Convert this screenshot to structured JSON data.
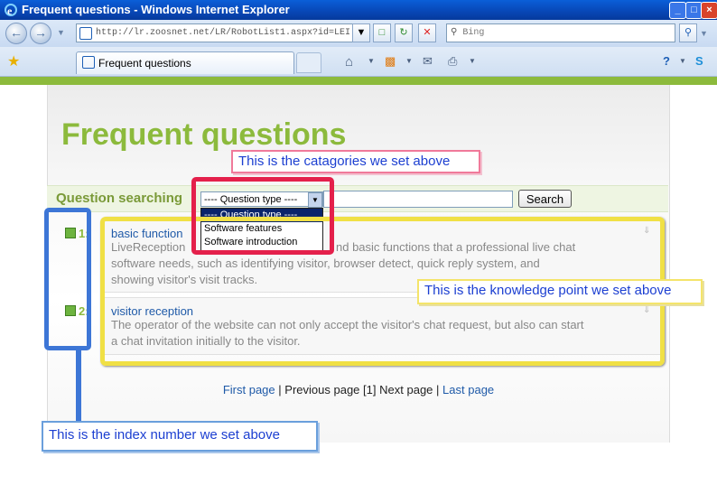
{
  "window": {
    "title": "Frequent questions - Windows Internet Explorer",
    "min": "_",
    "max": "□",
    "close": "×"
  },
  "address": {
    "url": "http://lr.zoosnet.net/LR/RobotList1.aspx?id=LEI",
    "search_placeholder": "Bing"
  },
  "tab": {
    "label": "Frequent questions"
  },
  "page": {
    "title": "Frequent questions",
    "search_label": "Question searching",
    "select_value": "---- Question type ----",
    "search_button": "Search",
    "dropdown": [
      "---- Question type ----",
      "Software features",
      "Software introduction"
    ],
    "questions": [
      {
        "number": "1:",
        "title": "basic function",
        "text_line1": "LiveReception",
        "text_line1b": "nd basic functions that a professional live chat",
        "text_line2": "software needs, such as identifying visitor, browser detect, quick reply system, and",
        "text_line3": "showing visitor's visit tracks."
      },
      {
        "number": "2:",
        "title": "visitor reception",
        "text_line1": "The operator of the website can not only accept the visitor's chat request, but also can start",
        "text_line2": "a chat invitation initially to the visitor."
      }
    ],
    "pager": {
      "first": "First page",
      "sep1": "|",
      "previous": "Previous page",
      "current": "[1]",
      "next": "Next page",
      "sep2": "|",
      "last": "Last page"
    }
  },
  "annotations": {
    "categories": "This is the catagories we set above",
    "knowledge": "This is the knowledge point we set above",
    "index": "This is the index number we set above"
  },
  "colors": {
    "accent_green": "#8cba3c",
    "annotation_red": "#e4204b",
    "annotation_yellow": "#f0e045",
    "annotation_blue": "#3d76d6"
  }
}
